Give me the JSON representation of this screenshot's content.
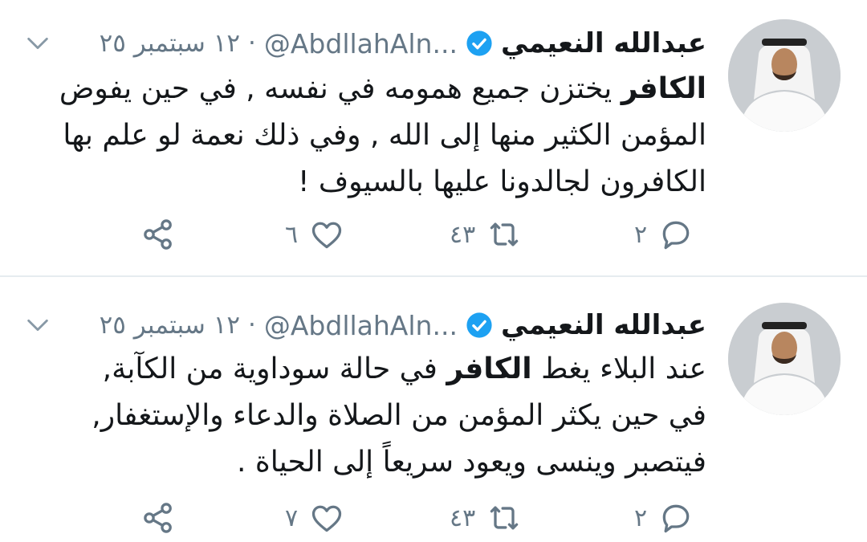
{
  "tweets": [
    {
      "author_name": "عبدالله النعيمي",
      "handle": "@AbdllahAln...",
      "separator": "·",
      "date": "١٢ سبتمبر ٢٥",
      "text_highlight": "الكافر",
      "text_rest": " يختزن جميع همومه في نفسه , في حين يفوض المؤمن الكثير منها إلى الله , وفي ذلك نعمة لو علم بها الكافرون لجالدونا عليها بالسيوف !",
      "replies": "٢",
      "retweets": "٤٣",
      "likes": "٦"
    },
    {
      "author_name": "عبدالله النعيمي",
      "handle": "@AbdllahAln...",
      "separator": "·",
      "date": "١٢ سبتمبر ٢٥",
      "text_before": "عند البلاء يغط ",
      "text_highlight": "الكافر",
      "text_rest": " في حالة سوداوية من الكآبة, في حين يكثر المؤمن من الصلاة والدعاء والإستغفار, فيتصبر وينسى ويعود سريعاً إلى الحياة .",
      "replies": "٢",
      "retweets": "٤٣",
      "likes": "٧"
    }
  ],
  "icons": {
    "verified": "verified-badge-icon",
    "caret": "chevron-down-icon",
    "reply": "reply-icon",
    "retweet": "retweet-icon",
    "like": "heart-icon",
    "share": "share-icon"
  },
  "colors": {
    "text": "#14171a",
    "secondary": "#657786",
    "verified": "#1da1f2",
    "divider": "#e6ecf0"
  }
}
